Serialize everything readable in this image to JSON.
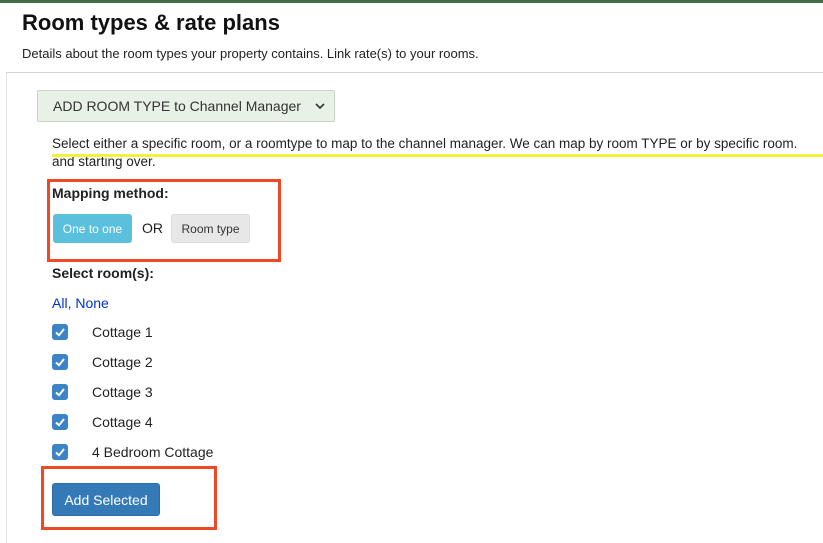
{
  "header": {
    "title": "Room types & rate plans",
    "subtitle": "Details about the room types your property contains. Link rate(s) to your rooms."
  },
  "room_type_select": {
    "selected": "ADD ROOM TYPE to Channel Manager"
  },
  "info": {
    "line1": "Select either a specific room, or a roomtype to map to the channel manager. We can map by room TYPE or by specific room.",
    "line2": "and starting over."
  },
  "mapping": {
    "label": "Mapping method:",
    "one_to_one": "One to one",
    "or": "OR",
    "room_type": "Room type"
  },
  "rooms": {
    "label": "Select room(s):",
    "all": "All",
    "separator": ",",
    "none": "None",
    "items": [
      {
        "name": "Cottage 1",
        "checked": true
      },
      {
        "name": "Cottage 2",
        "checked": true
      },
      {
        "name": "Cottage 3",
        "checked": true
      },
      {
        "name": "Cottage 4",
        "checked": true
      },
      {
        "name": "4 Bedroom Cottage",
        "checked": true
      }
    ]
  },
  "add_button": "Add Selected",
  "colors": {
    "accent_bar": "#3f6e45",
    "primary": "#337ab7",
    "info": "#5bc0de",
    "checkbox": "#3d84c6",
    "highlight_box": "#ef4826",
    "underline": "#f3f13a",
    "link": "#0033cc"
  }
}
